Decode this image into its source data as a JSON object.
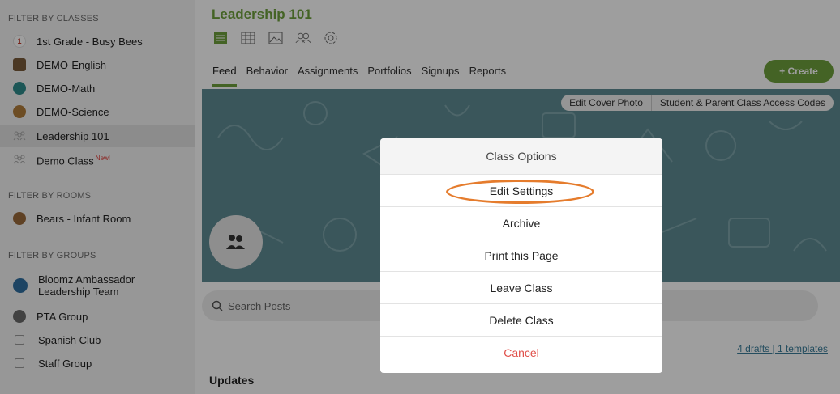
{
  "sidebar": {
    "classes_header": "FILTER BY CLASSES",
    "classes": [
      {
        "label": "1st Grade - Busy Bees",
        "icon": "first-grade-icon",
        "badge": ""
      },
      {
        "label": "DEMO-English",
        "icon": "books-icon",
        "badge": ""
      },
      {
        "label": "DEMO-Math",
        "icon": "math-icon",
        "badge": ""
      },
      {
        "label": "DEMO-Science",
        "icon": "science-icon",
        "badge": ""
      },
      {
        "label": "Leadership 101",
        "icon": "group-icon",
        "badge": ""
      },
      {
        "label": "Demo Class",
        "icon": "group-icon",
        "badge": "New!"
      }
    ],
    "rooms_header": "FILTER BY ROOMS",
    "rooms": [
      {
        "label": "Bears - Infant Room",
        "icon": "bear-icon"
      }
    ],
    "groups_header": "FILTER BY GROUPS",
    "groups": [
      {
        "label": "Bloomz Ambassador Leadership Team",
        "icon": "bloomz-icon"
      },
      {
        "label": "PTA Group",
        "icon": "pta-icon"
      },
      {
        "label": "Spanish Club",
        "icon": "square-icon"
      },
      {
        "label": "Staff Group",
        "icon": "square-icon"
      }
    ]
  },
  "header": {
    "title": "Leadership 101",
    "tabs": [
      "Feed",
      "Behavior",
      "Assignments",
      "Portfolios",
      "Signups",
      "Reports"
    ],
    "active_tab": "Feed",
    "create_label": "+ Create"
  },
  "cover": {
    "edit_cover": "Edit Cover Photo",
    "access_codes": "Student & Parent Class Access Codes"
  },
  "search": {
    "placeholder": "Search Posts"
  },
  "drafts_link": "4 drafts | 1 templates",
  "updates_label": "Updates",
  "modal": {
    "title": "Class Options",
    "options": [
      "Edit Settings",
      "Archive",
      "Print this Page",
      "Leave Class",
      "Delete Class"
    ],
    "cancel": "Cancel"
  },
  "colors": {
    "brand_green": "#6ea13c",
    "cover_teal": "#5e8b93",
    "highlight_orange": "#e57c2d",
    "cancel_red": "#e0504a"
  }
}
